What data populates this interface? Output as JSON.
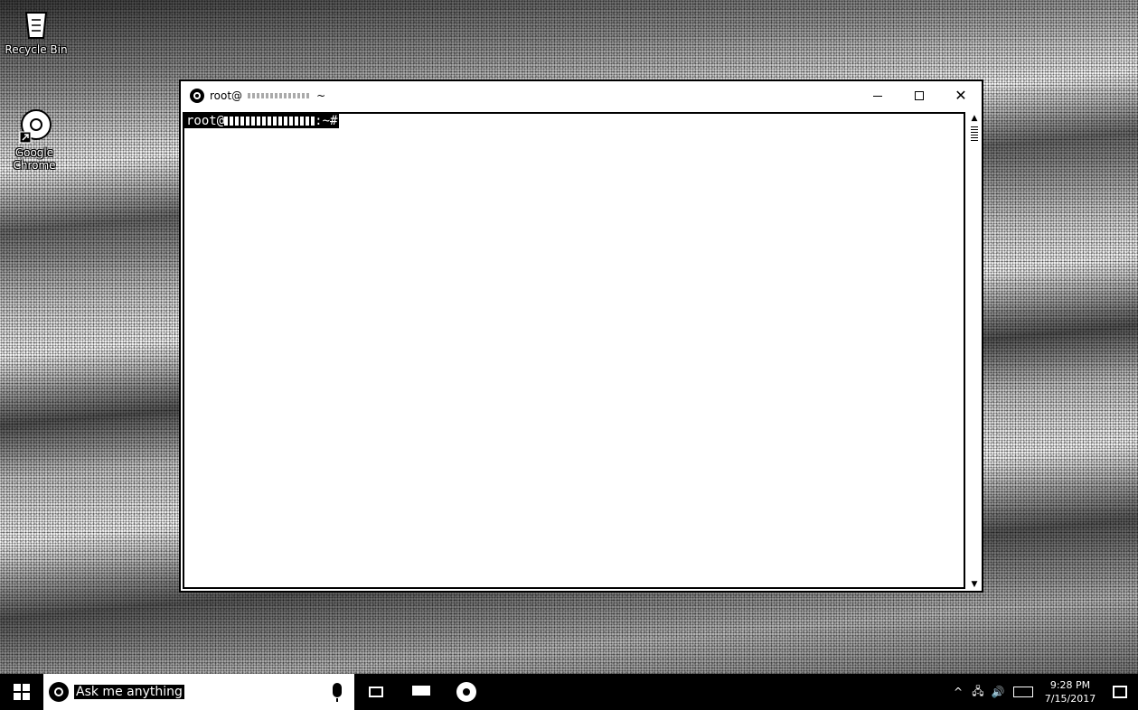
{
  "desktop": {
    "icons": [
      {
        "label": "Recycle Bin",
        "icon": "recycle-bin-icon"
      },
      {
        "label": "Google Chrome",
        "icon": "chrome-icon"
      }
    ]
  },
  "terminal": {
    "title_prefix": "root@",
    "title_suffix": "~",
    "prompt_user": "root@",
    "prompt_suffix": ":~#",
    "controls": {
      "minimize": "minimize",
      "maximize": "maximize",
      "close": "close"
    }
  },
  "taskbar": {
    "search_placeholder": "Ask me anything",
    "clock_time": "9:28 PM",
    "clock_date": "7/15/2017",
    "tray_chevron": "^",
    "tray_network": "🖧",
    "tray_volume": "🔊"
  },
  "colors": {
    "window_bg": "#ffffff",
    "taskbar_bg": "#000000",
    "border": "#000000"
  }
}
